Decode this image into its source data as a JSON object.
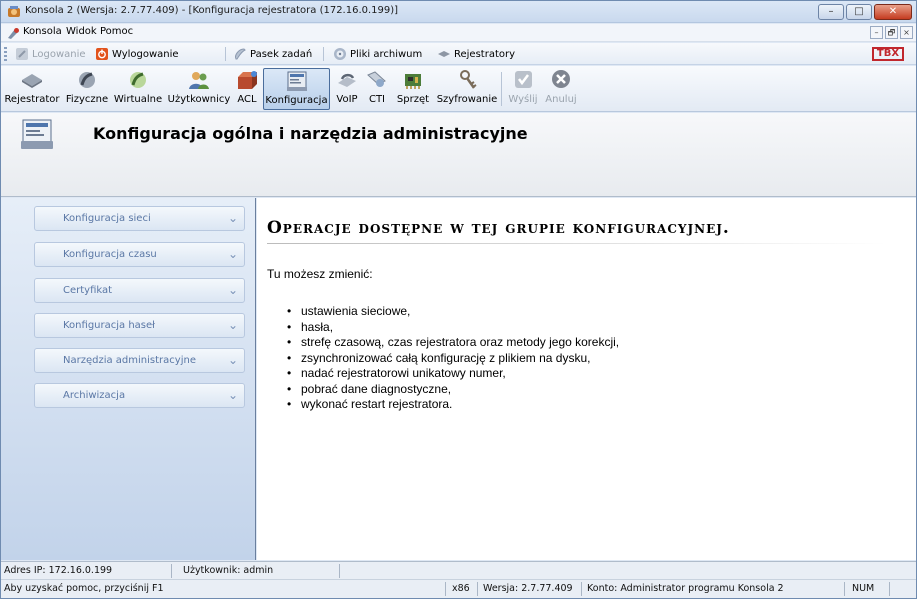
{
  "window": {
    "title": "Konsola 2 (Wersja:  2.7.77.409) - [Konfiguracja rejestratora (172.16.0.199)]",
    "caption_buttons": {
      "minimize": "–",
      "maximize": "□",
      "close": "✕"
    },
    "mdi_buttons": {
      "minimize": "–",
      "restore": "🗗",
      "close": "×"
    }
  },
  "menu": {
    "items": [
      "Konsola",
      "Widok",
      "Pomoc"
    ]
  },
  "linkbar": {
    "items": [
      {
        "label": "Logowanie",
        "icon": "login-icon",
        "disabled": true
      },
      {
        "label": "Wylogowanie",
        "icon": "logout-icon",
        "disabled": false
      },
      {
        "label": "Pasek zadań",
        "icon": "taskbar-icon",
        "disabled": false
      },
      {
        "label": "Pliki archiwum",
        "icon": "archive-files-icon",
        "disabled": false
      },
      {
        "label": "Rejestratory",
        "icon": "recorders-icon",
        "disabled": false
      }
    ],
    "logo_text": "TBX"
  },
  "toolbar": {
    "items": [
      {
        "label": "Rejestrator",
        "icon": "recorder-icon",
        "active": false,
        "disabled": false
      },
      {
        "label": "Fizyczne",
        "icon": "physical-channels-icon",
        "active": false,
        "disabled": false
      },
      {
        "label": "Wirtualne",
        "icon": "virtual-channels-icon",
        "active": false,
        "disabled": false
      },
      {
        "label": "Użytkownicy",
        "icon": "users-icon",
        "active": false,
        "disabled": false
      },
      {
        "label": "ACL",
        "icon": "acl-icon",
        "active": false,
        "disabled": false
      },
      {
        "label": "Konfiguracja",
        "icon": "configuration-icon",
        "active": true,
        "disabled": false
      },
      {
        "label": "VoIP",
        "icon": "voip-icon",
        "active": false,
        "disabled": false
      },
      {
        "label": "CTI",
        "icon": "cti-icon",
        "active": false,
        "disabled": false
      },
      {
        "label": "Sprzęt",
        "icon": "hardware-icon",
        "active": false,
        "disabled": false
      },
      {
        "label": "Szyfrowanie",
        "icon": "encryption-icon",
        "active": false,
        "disabled": false
      },
      {
        "label": "Wyślij",
        "icon": "send-icon",
        "active": false,
        "disabled": true
      },
      {
        "label": "Anuluj",
        "icon": "cancel-icon",
        "active": false,
        "disabled": true
      }
    ]
  },
  "header": {
    "title": "Konfiguracja ogólna i narzędzia administracyjne"
  },
  "sidebar": {
    "items": [
      {
        "label": "Konfiguracja sieci"
      },
      {
        "label": "Konfiguracja czasu"
      },
      {
        "label": "Certyfikat"
      },
      {
        "label": "Konfiguracja haseł"
      },
      {
        "label": "Narzędzia administracyjne"
      },
      {
        "label": "Archiwizacja"
      }
    ],
    "chevron": "⌄"
  },
  "content": {
    "heading": "Operacje dostępne w tej grupie konfiguracyjnej.",
    "intro": "Tu możesz zmienić:",
    "bullets": [
      "ustawienia sieciowe,",
      "hasła,",
      "strefę czasową, czas rejestratora oraz metody jego korekcji,",
      "zsynchronizować całą konfigurację z plikiem na dysku,",
      "nadać rejestratorowi unikatowy numer,",
      "pobrać dane diagnostyczne,",
      "wykonać restart rejestratora."
    ]
  },
  "status": {
    "ip": "Adres IP: 172.16.0.199",
    "user": "Użytkownik: admin",
    "help": "Aby uzyskać pomoc, przyciśnij F1",
    "arch": "x86",
    "version": "Wersja: 2.7.77.409",
    "account": "Konto: Administrator programu Konsola 2",
    "num": "NUM"
  }
}
